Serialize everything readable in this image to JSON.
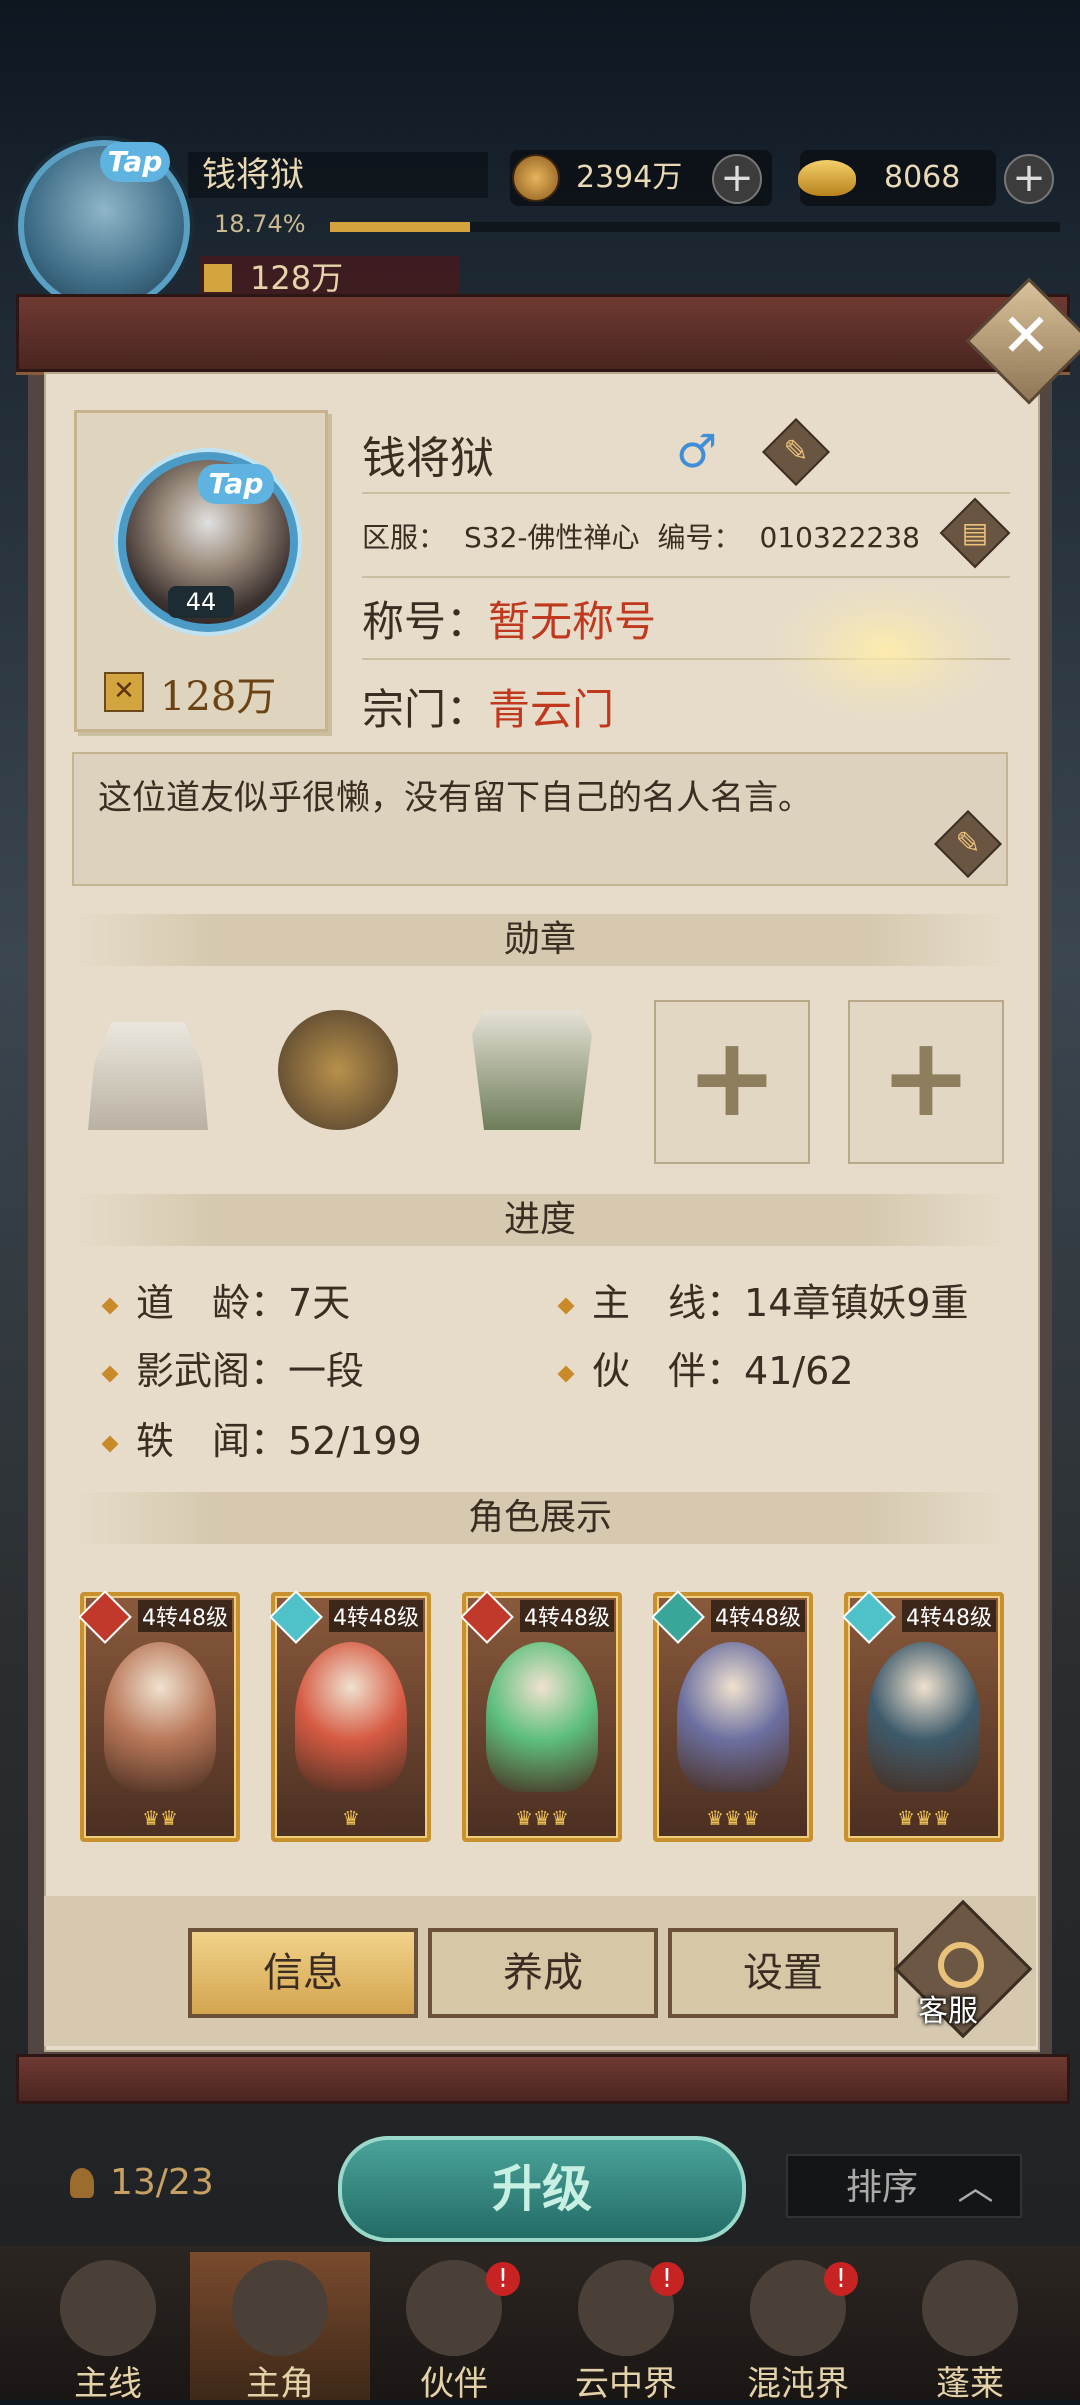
{
  "hud": {
    "player_name": "钱将狱",
    "tap_label": "Tap",
    "exp_percent": "18.74%",
    "power": "128万",
    "coins": "2394万",
    "gold": "8068",
    "plus": "+"
  },
  "profile": {
    "close_glyph": "✕",
    "portrait_tap": "Tap",
    "level": "44",
    "power": "128万",
    "power_icon": "✕",
    "name": "钱将狱",
    "gender_symbol": "♂",
    "server_label": "区服：",
    "server_value": "S32-佛性禅心",
    "id_label": "编号：",
    "id_value": "010322238",
    "title_label": "称号：",
    "title_value": "暂无称号",
    "sect_label": "宗门：",
    "sect_value": "青云门",
    "motto": "这位道友似乎很懒，没有留下自己的名人名言。"
  },
  "sections": {
    "medals": "勋章",
    "progress": "进度",
    "heroes": "角色展示"
  },
  "medals": {
    "plus": "+"
  },
  "progress": {
    "age_label": "道　龄：",
    "age_value": "7天",
    "main_label": "主　线：",
    "main_value": "14章镇妖9重",
    "pavilion_label": "影武阁：",
    "pavilion_value": "一段",
    "partner_label": "伙　伴：",
    "partner_value": "41/62",
    "lore_label": "轶　闻：",
    "lore_value": "52/199"
  },
  "heroes": [
    {
      "level": "4转48级",
      "stars": "♛♛",
      "element_color": "#c0392b",
      "figure_color": "#b9785a"
    },
    {
      "level": "4转48级",
      "stars": "♛",
      "element_color": "#4fc1c9",
      "figure_color": "#d65a43"
    },
    {
      "level": "4转48级",
      "stars": "♛♛♛",
      "element_color": "#c0392b",
      "figure_color": "#5dbf7d"
    },
    {
      "level": "4转48级",
      "stars": "♛♛♛",
      "element_color": "#3aa69a",
      "figure_color": "#6b6fa0"
    },
    {
      "level": "4转48级",
      "stars": "♛♛♛",
      "element_color": "#4fc1c9",
      "figure_color": "#3d5a6b"
    }
  ],
  "buttons": {
    "info": "信息",
    "develop": "养成",
    "settings": "设置",
    "service": "客服"
  },
  "bottom": {
    "count": "13/23",
    "upgrade": "升级",
    "sort": "排序",
    "sort_arrow": "︿"
  },
  "nav": {
    "mainline": "主线",
    "hero": "主角",
    "partner": "伙伴",
    "cloud": "云中界",
    "chaos": "混沌界",
    "penglai": "蓬莱",
    "badge": "!"
  }
}
